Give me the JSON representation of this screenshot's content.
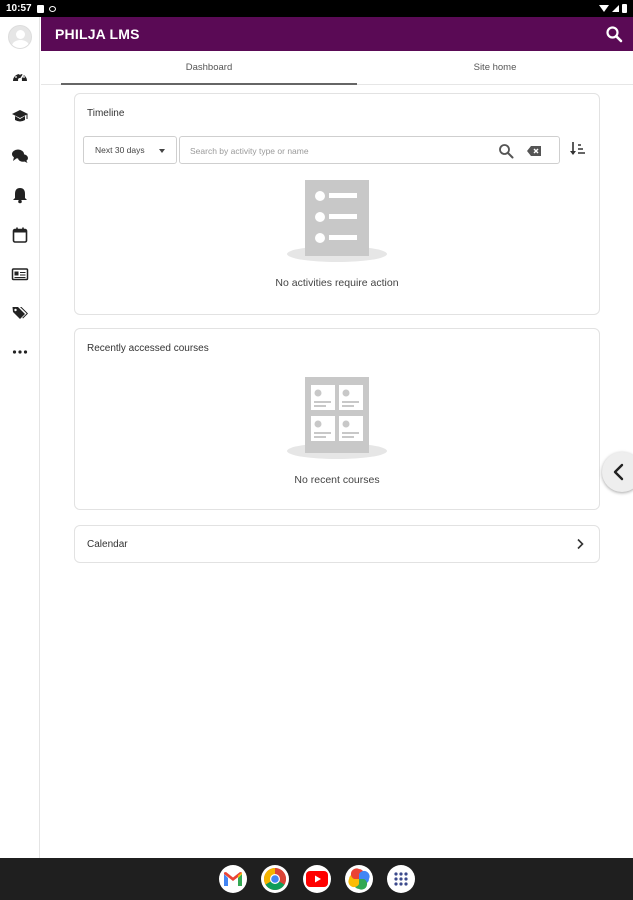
{
  "status_bar": {
    "time": "10:57"
  },
  "header": {
    "title": "PHILJA LMS"
  },
  "tabs": [
    {
      "label": "Dashboard",
      "active": true
    },
    {
      "label": "Site home",
      "active": false
    }
  ],
  "timeline": {
    "title": "Timeline",
    "filter_value": "Next 30 days",
    "search_placeholder": "Search by activity type or name",
    "empty_message": "No activities require action"
  },
  "recent_courses": {
    "title": "Recently accessed courses",
    "empty_message": "No recent courses"
  },
  "calendar": {
    "title": "Calendar"
  },
  "sidebar": {
    "items": [
      {
        "icon": "avatar"
      },
      {
        "icon": "dashboard-icon"
      },
      {
        "icon": "graduation-cap-icon"
      },
      {
        "icon": "messages-icon"
      },
      {
        "icon": "bell-icon"
      },
      {
        "icon": "calendar-icon"
      },
      {
        "icon": "id-card-icon"
      },
      {
        "icon": "tags-icon"
      },
      {
        "icon": "more-icon"
      }
    ]
  },
  "colors": {
    "header": "#5a0a55",
    "navbar": "#1f1f1f"
  },
  "dock_apps": [
    "gmail-icon",
    "chrome-icon",
    "youtube-icon",
    "photos-icon",
    "app-drawer-icon"
  ]
}
